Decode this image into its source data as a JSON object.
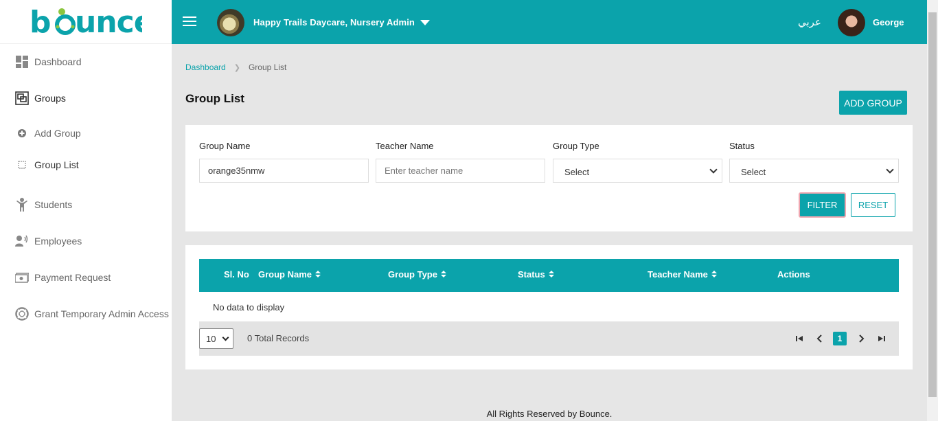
{
  "brand": {
    "logo_text": "bounce",
    "accent": "#0ba3ab"
  },
  "sidebar": {
    "items": [
      {
        "label": "Dashboard",
        "icon": "dashboard-icon"
      },
      {
        "label": "Groups",
        "icon": "groups-icon"
      },
      {
        "label": "Add Group",
        "icon": "plus-circle-icon"
      },
      {
        "label": "Group List",
        "icon": "list-square-icon"
      },
      {
        "label": "Students",
        "icon": "student-icon"
      },
      {
        "label": "Employees",
        "icon": "employee-icon"
      },
      {
        "label": "Payment Request",
        "icon": "payment-icon"
      },
      {
        "label": "Grant Temporary Admin Access",
        "icon": "lifebuoy-icon"
      }
    ]
  },
  "header": {
    "org_name": "Happy Trails Daycare, Nursery Admin",
    "language": "عربي",
    "user_name": "George"
  },
  "breadcrumb": {
    "root": "Dashboard",
    "current": "Group List"
  },
  "page": {
    "title": "Group List",
    "add_button": "ADD GROUP"
  },
  "filters": {
    "group_name_label": "Group Name",
    "group_name_value": "orange35nmw",
    "teacher_name_label": "Teacher Name",
    "teacher_name_placeholder": "Enter teacher name",
    "group_type_label": "Group Type",
    "group_type_value": "Select",
    "status_label": "Status",
    "status_value": "Select",
    "filter_button": "FILTER",
    "reset_button": "RESET"
  },
  "table": {
    "columns": [
      "Sl. No",
      "Group Name",
      "Group Type",
      "Status",
      "Teacher Name",
      "Actions"
    ],
    "empty_text": "No data to display",
    "page_size": "10",
    "total_records": "0 Total Records",
    "current_page": "1"
  },
  "footer": {
    "text": "All Rights Reserved by Bounce."
  }
}
